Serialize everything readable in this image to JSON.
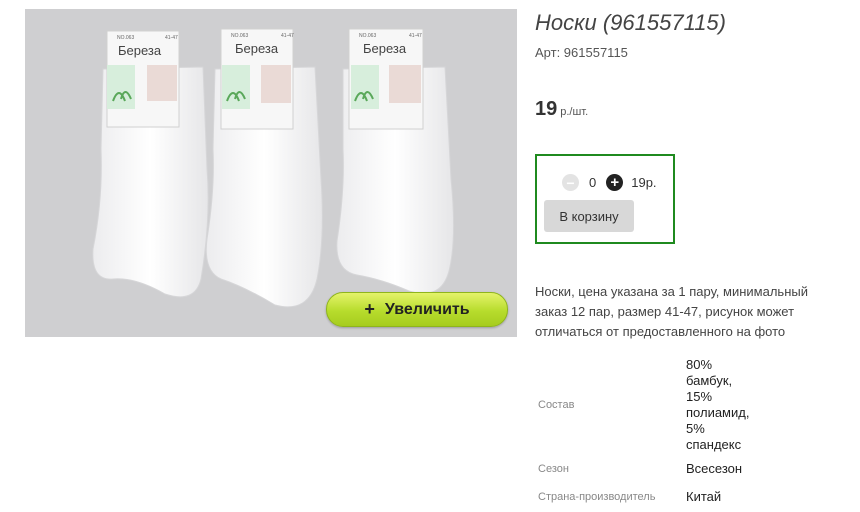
{
  "product": {
    "title": "Носки (961557115)",
    "article": "Арт: 961557115",
    "price_value": "19",
    "price_unit": "р./шт.",
    "description": "Носки, цена указана за 1 пару, минимальный заказ 12 пар, размер 41-47, рисунок может отличаться от предоставленного на фото"
  },
  "image": {
    "zoom_label": "Увеличить",
    "zoom_icon": "+",
    "label_brand": "Береза",
    "label_code": "NO.063",
    "label_size": "41-47"
  },
  "cart": {
    "minus_icon": "−",
    "quantity": "0",
    "plus_icon": "+",
    "sum": "19р.",
    "add_label": "В корзину"
  },
  "properties": [
    {
      "name": "Состав",
      "lines": [
        "80%",
        "бамбук,",
        "15%",
        "полиамид,",
        "5%",
        "спандекс"
      ]
    },
    {
      "name": "Сезон",
      "value": "Всесезон"
    },
    {
      "name": "Страна-производитель",
      "value": "Китай"
    }
  ],
  "colors": {
    "cart_border": "#1f8a1f",
    "zoom_button": "#b7dc2c"
  }
}
